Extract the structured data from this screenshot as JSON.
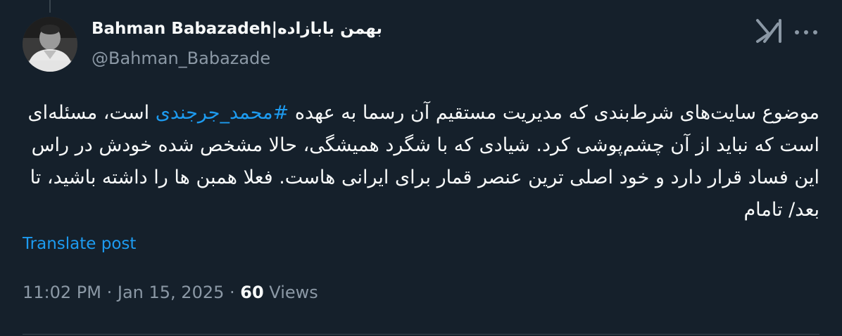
{
  "author": {
    "display_name": "Bahman Babazadeh|بهمن بابازاده",
    "handle": "@Bahman_Babazade"
  },
  "icons": {
    "avatar": "profile-photo",
    "grok": "grok-icon",
    "more": "more-options-icon"
  },
  "post": {
    "text_before_hashtag": "موضوع سایت‌های شرط‌بندی که مدیریت مستقیم آن رسما به عهده ",
    "hashtag": "#محمد_جرجندی",
    "text_after_hashtag": " است، مسئله‌ای است که نباید از آن چشم‌پوشی کرد. شیادی که با شگرد همیشگی، حالا مشخص شده خودش در راس این فساد قرار دارد و خود اصلی ترین عنصر قمار برای ایرانی هاست. فعلا همبن ها را داشته باشید، تا بعد/ تامام"
  },
  "translate_label": "Translate post",
  "meta": {
    "time": "11:02 PM",
    "sep1": " · ",
    "date": "Jan 15, 2025",
    "sep2": " · ",
    "views_count": "60",
    "views_label": " Views"
  },
  "colors": {
    "background": "#15202b",
    "text": "#f7f9f9",
    "secondary": "#8b98a5",
    "link": "#1d9bf0",
    "divider": "#38444d"
  }
}
